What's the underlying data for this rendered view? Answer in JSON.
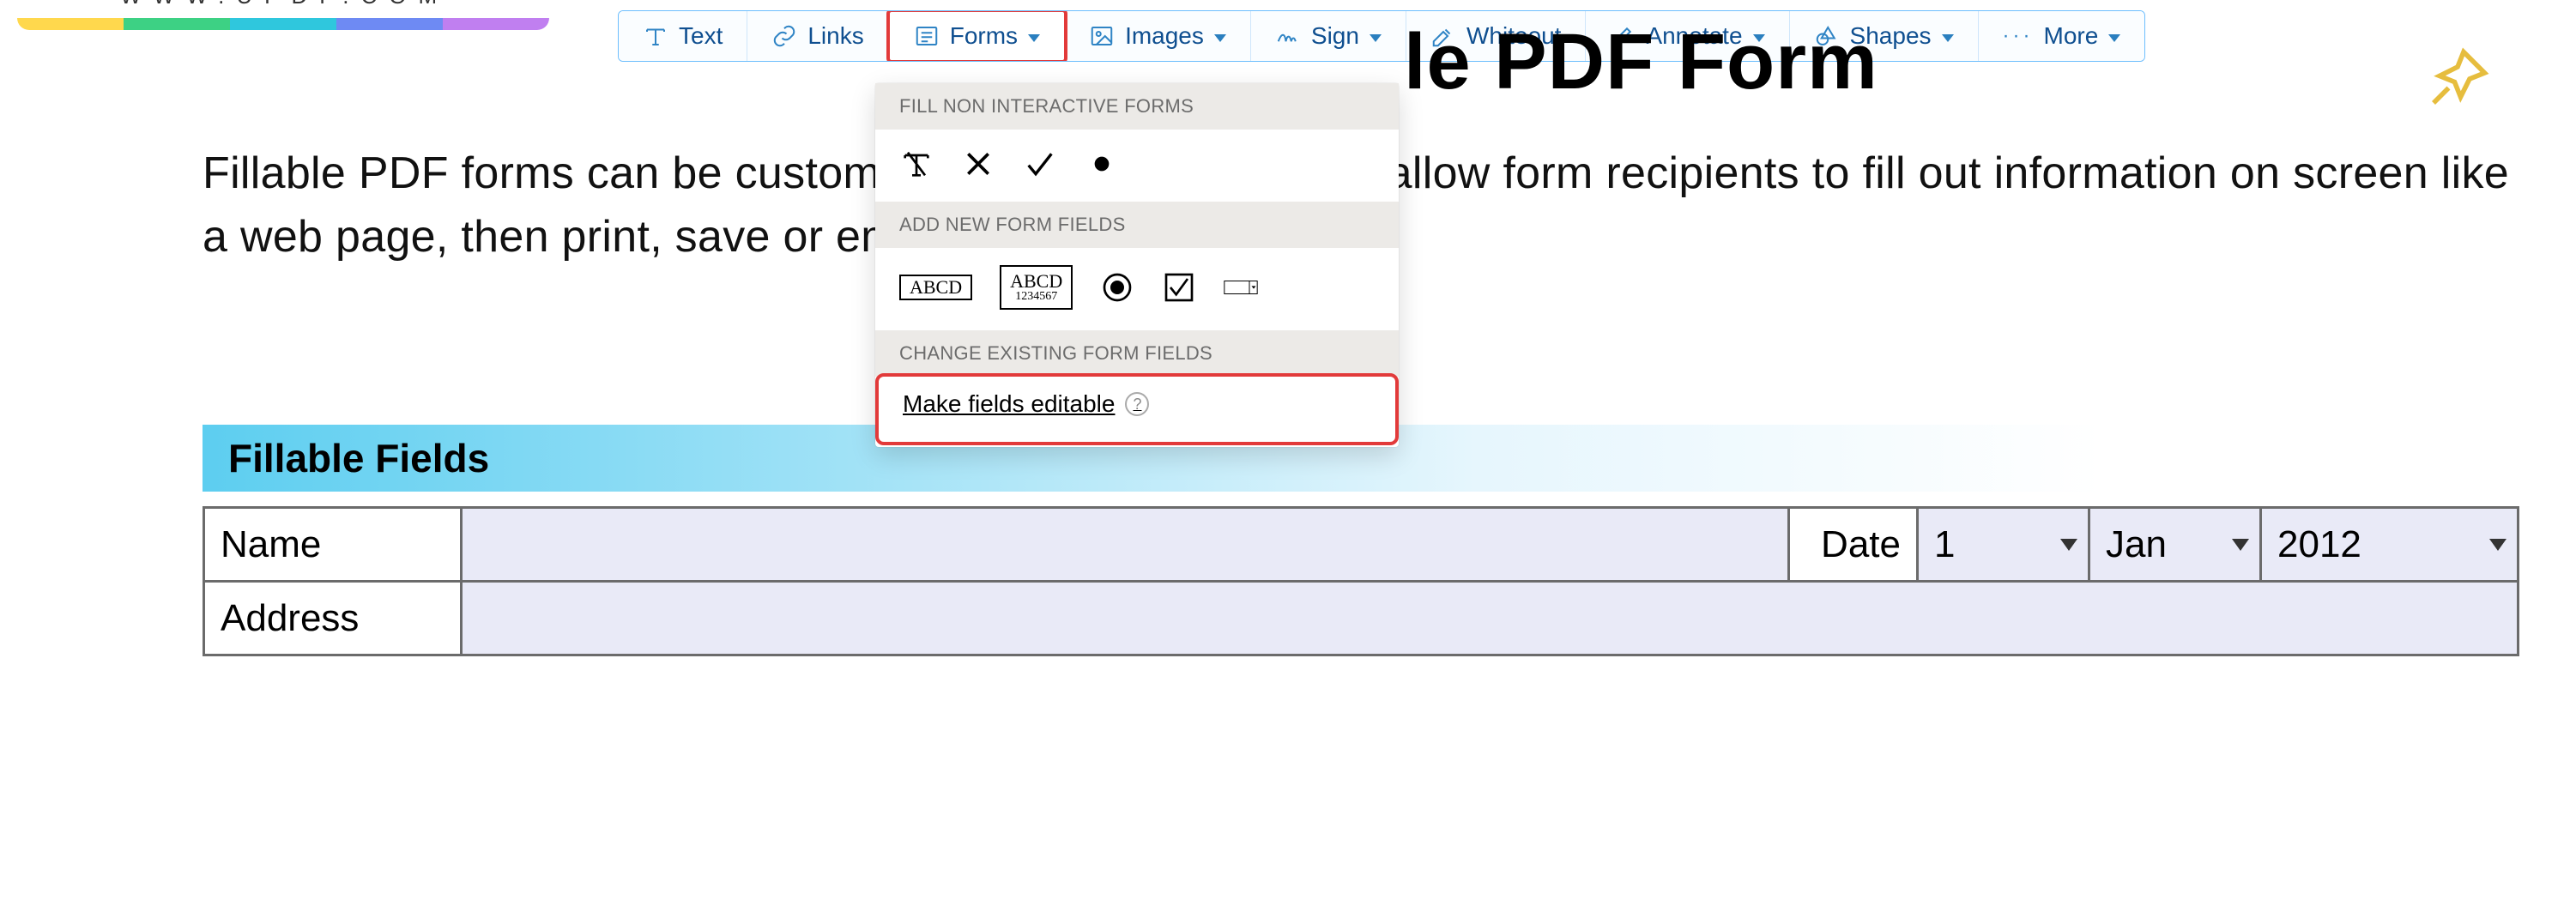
{
  "logo": {
    "url_text": "WWW.UPDF.COM"
  },
  "toolbar": {
    "text": "Text",
    "links": "Links",
    "forms": "Forms",
    "images": "Images",
    "sign": "Sign",
    "whiteout": "Whiteout",
    "annotate": "Annotate",
    "shapes": "Shapes",
    "more": "More"
  },
  "dropdown": {
    "fill_heading": "FILL NON INTERACTIVE FORMS",
    "add_heading": "ADD NEW FORM FIELDS",
    "change_heading": "CHANGE EXISTING FORM FIELDS",
    "make_editable": "Make fields editable",
    "abcd": "ABCD",
    "numbers": "1234567"
  },
  "page": {
    "title_fragment": "le PDF Form",
    "body_text": "Fillable PDF forms can be customised to your needs. They allow form recipients to fill out information on screen like a web page, then print, save or email the results.",
    "section_title": "Fillable Fields"
  },
  "form": {
    "name_label": "Name",
    "address_label": "Address",
    "date_label": "Date",
    "day": "1",
    "month": "Jan",
    "year": "2012"
  }
}
